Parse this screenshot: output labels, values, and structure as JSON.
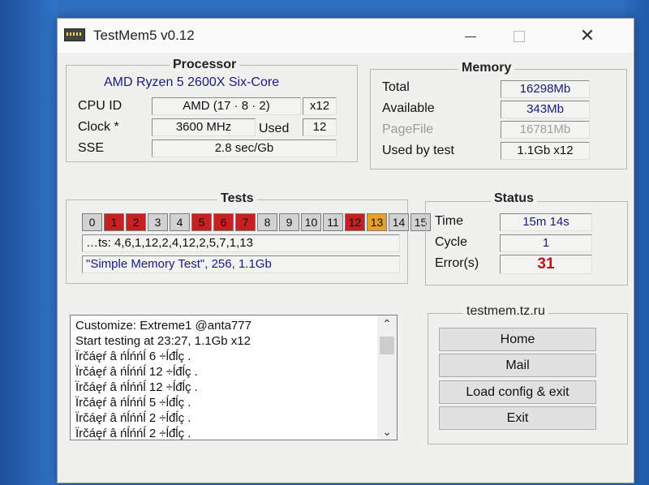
{
  "window": {
    "title": "TestMem5 v0.12"
  },
  "processor": {
    "title": "Processor",
    "name": "AMD Ryzen 5 2600X Six-Core",
    "cpu_id_label": "CPU ID",
    "cpu_id_value": "AMD  (17 · 8 · 2)",
    "threads": "x12",
    "clock_label": "Clock *",
    "clock_value": "3600 MHz",
    "used_label": "Used",
    "used_value": "12",
    "sse_label": "SSE",
    "sse_value": "2.8 sec/Gb"
  },
  "memory": {
    "title": "Memory",
    "total_label": "Total",
    "total_value": "16298Mb",
    "available_label": "Available",
    "available_value": "343Mb",
    "pagefile_label": "PageFile",
    "pagefile_value": "16781Mb",
    "used_label": "Used by test",
    "used_value": "1.1Gb x12"
  },
  "tests": {
    "title": "Tests",
    "cells": [
      {
        "label": "0",
        "state": "normal"
      },
      {
        "label": "1",
        "state": "error"
      },
      {
        "label": "2",
        "state": "error"
      },
      {
        "label": "3",
        "state": "normal"
      },
      {
        "label": "4",
        "state": "normal"
      },
      {
        "label": "5",
        "state": "error"
      },
      {
        "label": "6",
        "state": "error"
      },
      {
        "label": "7",
        "state": "error"
      },
      {
        "label": "8",
        "state": "normal"
      },
      {
        "label": "9",
        "state": "normal"
      },
      {
        "label": "10",
        "state": "normal"
      },
      {
        "label": "11",
        "state": "normal"
      },
      {
        "label": "12",
        "state": "error"
      },
      {
        "label": "13",
        "state": "current"
      },
      {
        "label": "14",
        "state": "normal"
      },
      {
        "label": "15",
        "state": "normal"
      }
    ],
    "sequence": "…ts: 4,6,1,12,2,4,12,2,5,7,1,13",
    "current": "\"Simple Memory Test\", 256, 1.1Gb"
  },
  "status": {
    "title": "Status",
    "time_label": "Time",
    "time_value": "15m 14s",
    "cycle_label": "Cycle",
    "cycle_value": "1",
    "errors_label": "Error(s)",
    "errors_value": "31"
  },
  "log": {
    "lines": [
      "Customize: Extreme1 @anta777",
      "Start testing at 23:27, 1.1Gb x12",
      "Ïrčáęŕ â ńĺńńĺ 6 ÷ĺđĺç .",
      "Ïrčáęŕ â ńĺńńĺ 12 ÷ĺđĺç .",
      "Ïrčáęŕ â ńĺńńĺ 12 ÷ĺđĺç .",
      "Ïrčáęŕ â ńĺńńĺ 5 ÷ĺđĺç .",
      "Ïrčáęŕ â ńĺńńĺ 2 ÷ĺđĺç .",
      "Ïrčáęŕ â ńĺńńĺ 2 ÷ĺđĺç ."
    ]
  },
  "links": {
    "site": "testmem.tz.ru",
    "home": "Home",
    "mail": "Mail",
    "load": "Load config & exit",
    "exit": "Exit"
  },
  "colors": {
    "error_cell": "#c82020",
    "current_cell": "#e8a028",
    "normal_cell": "#d2d2d2",
    "errors_text": "#b81515"
  }
}
